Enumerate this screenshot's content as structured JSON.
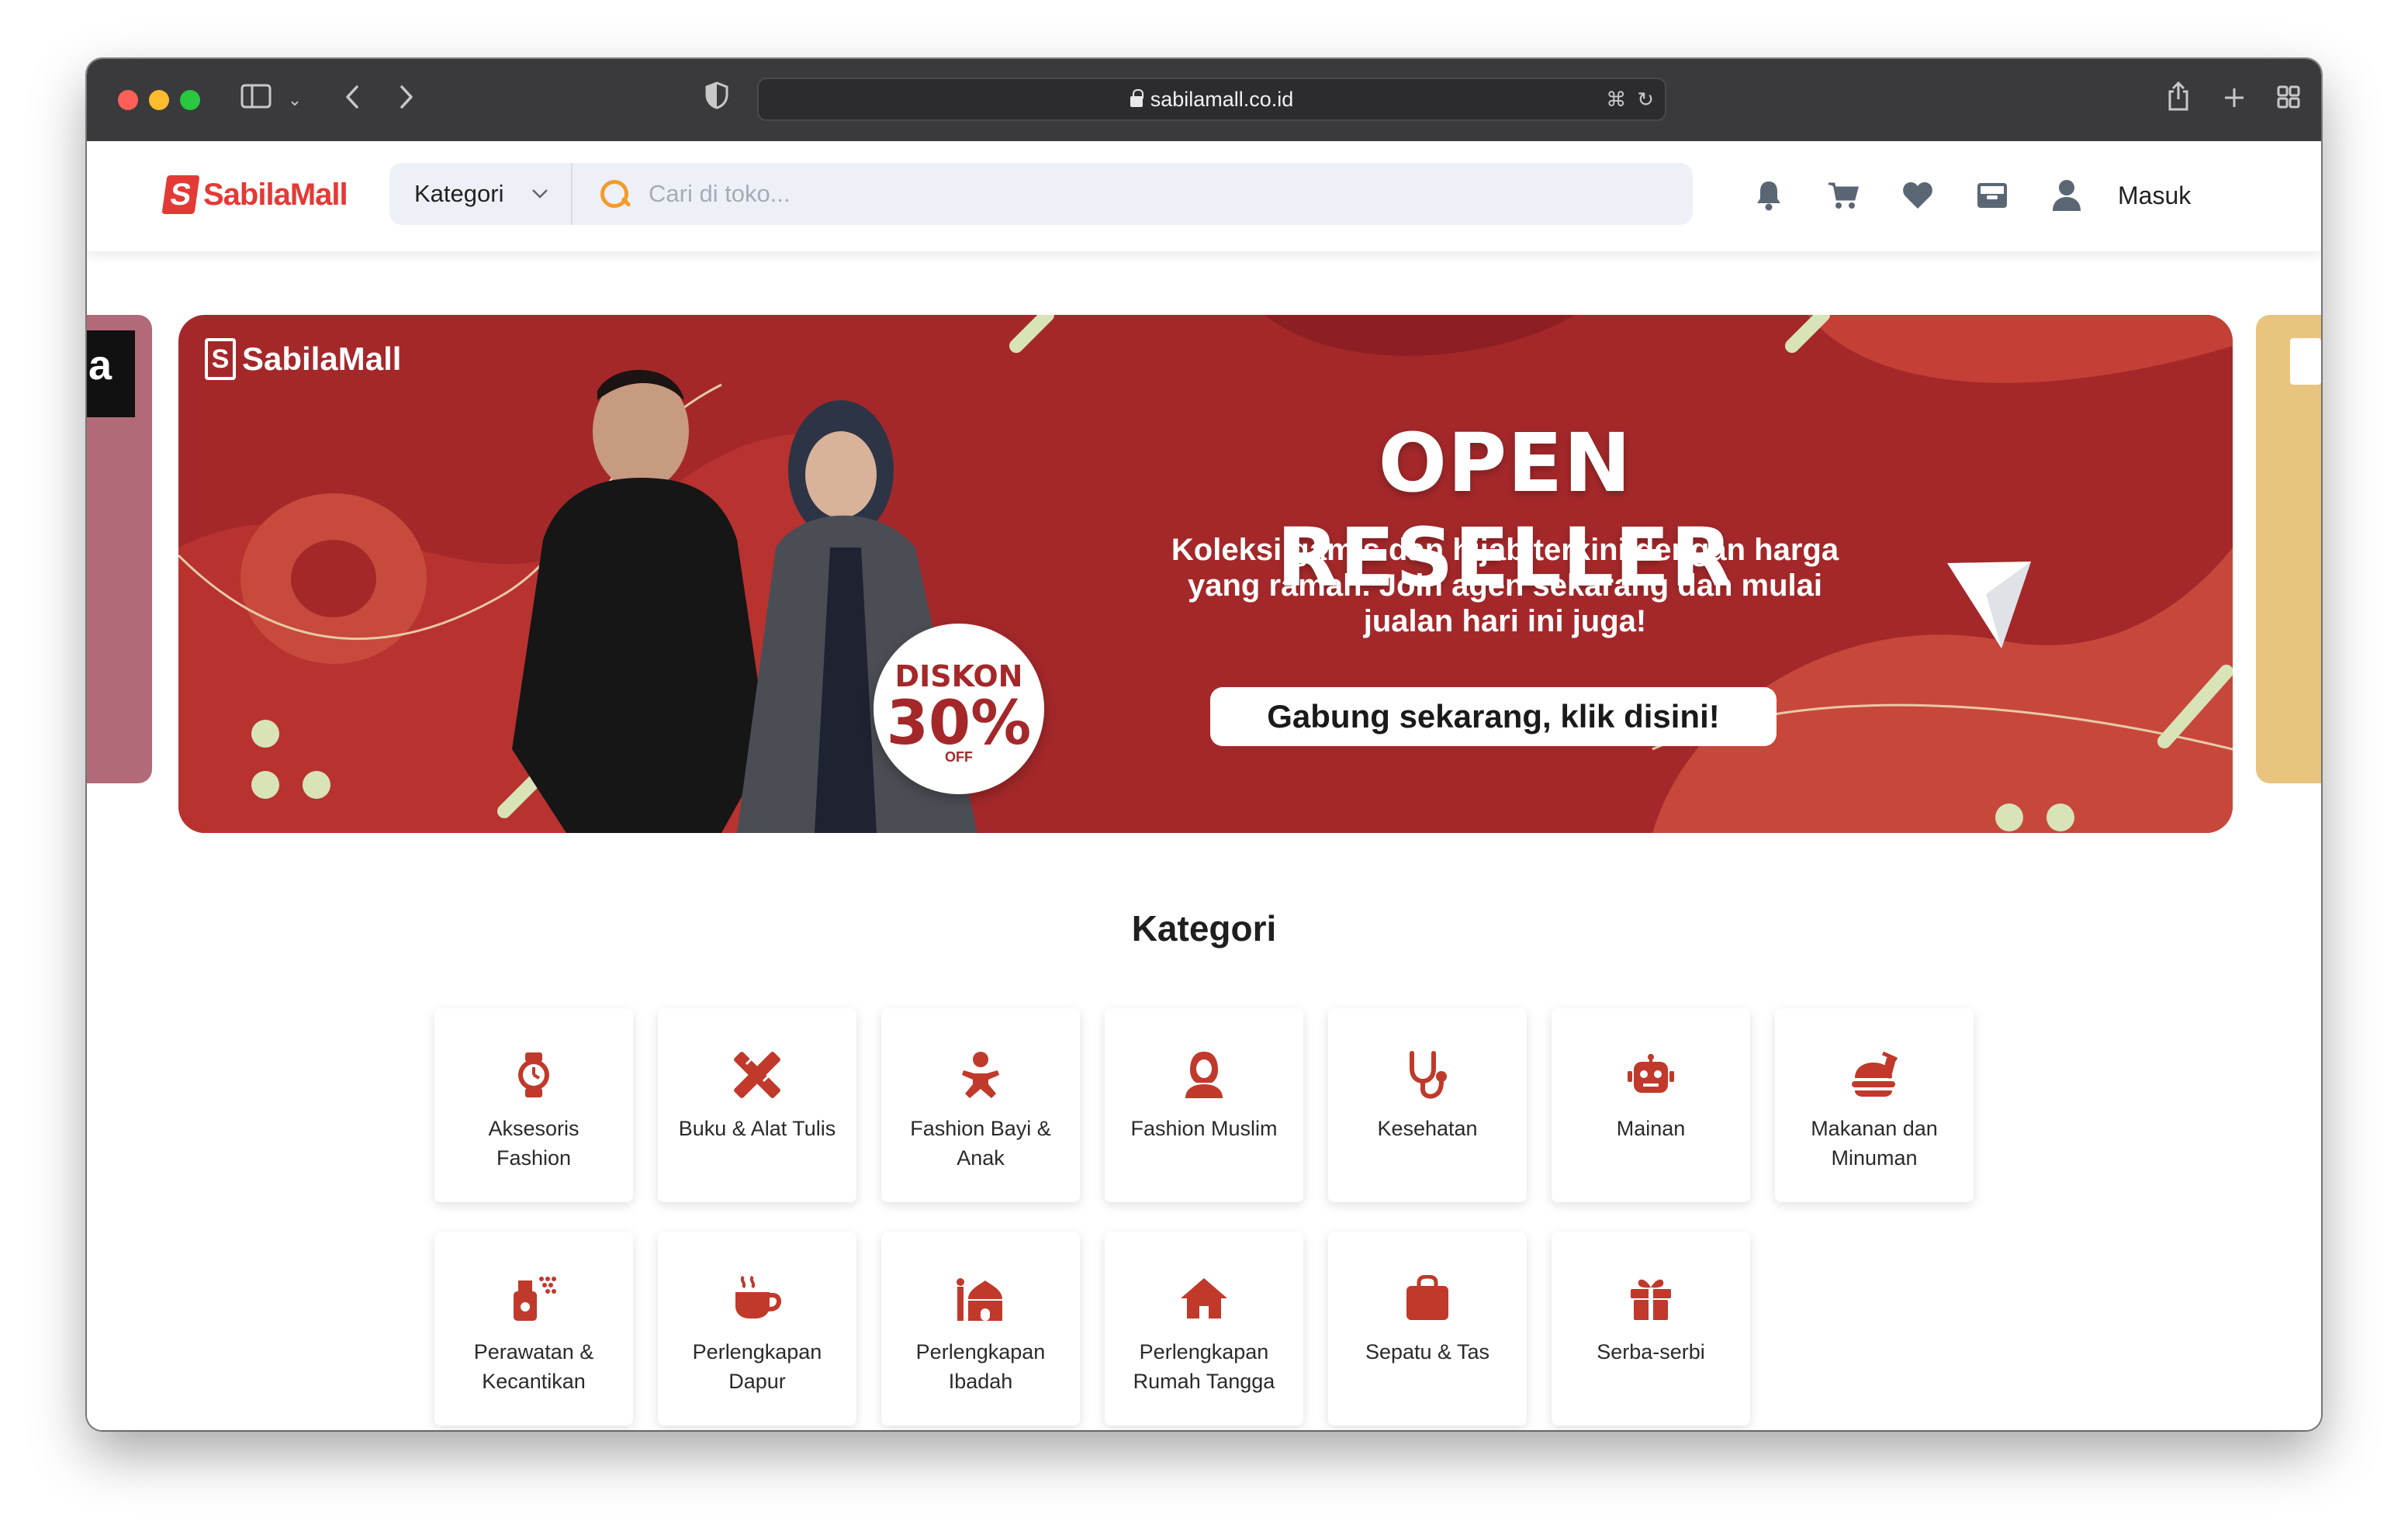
{
  "browser": {
    "url": "sabilamall.co.id"
  },
  "header": {
    "logo_text": "SabilaMall",
    "category_select": "Kategori",
    "search_placeholder": "Cari di toko...",
    "login_label": "Masuk"
  },
  "banner": {
    "logo_text": "SabilaMall",
    "headline": "OPEN RESELLER",
    "subtext": "Koleksi gamis dan hijab terkini dengan harga yang ramah. Join agen sekarang dan mulai jualan hari ini juga!",
    "cta": "Gabung sekarang, klik disini!",
    "discount_label": "DISKON",
    "discount_value": "30%",
    "discount_off": "OFF"
  },
  "categories": {
    "title": "Kategori",
    "items": [
      {
        "label": "Aksesoris Fashion",
        "icon": "watch-icon"
      },
      {
        "label": "Buku & Alat Tulis",
        "icon": "pencil-ruler-icon"
      },
      {
        "label": "Fashion Bayi & Anak",
        "icon": "baby-icon"
      },
      {
        "label": "Fashion Muslim",
        "icon": "hijab-icon"
      },
      {
        "label": "Kesehatan",
        "icon": "stethoscope-icon"
      },
      {
        "label": "Mainan",
        "icon": "robot-icon"
      },
      {
        "label": "Makanan dan Minuman",
        "icon": "food-icon"
      },
      {
        "label": "Perawatan & Kecantikan",
        "icon": "spray-bottle-icon"
      },
      {
        "label": "Perlengkapan Dapur",
        "icon": "mug-icon"
      },
      {
        "label": "Perlengkapan Ibadah",
        "icon": "mosque-icon"
      },
      {
        "label": "Perlengkapan Rumah Tangga",
        "icon": "home-icon"
      },
      {
        "label": "Sepatu & Tas",
        "icon": "bag-icon"
      },
      {
        "label": "Serba-serbi",
        "icon": "gift-icon"
      }
    ]
  },
  "colors": {
    "brand": "#e53935",
    "banner_bg": "#a4282a",
    "icon_red": "#c0392b",
    "header_icon": "#5b6675",
    "search_accent": "#f39c2b"
  }
}
